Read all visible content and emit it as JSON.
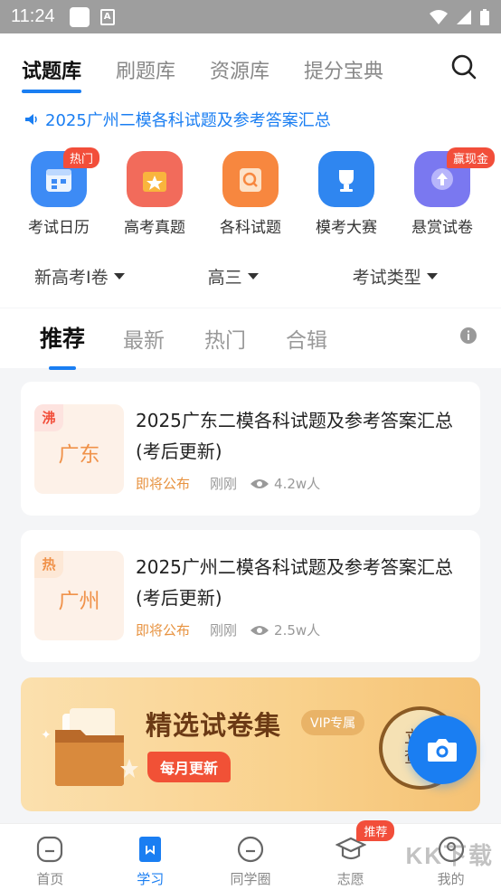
{
  "status_bar": {
    "time": "11:24"
  },
  "top_tabs": [
    "试题库",
    "刷题库",
    "资源库",
    "提分宝典"
  ],
  "notice": "2025广州二模各科试题及参考答案汇总",
  "quick_entries": [
    {
      "label": "考试日历",
      "badge": "热门",
      "color": "#3d8bf5",
      "icon": "calendar-icon"
    },
    {
      "label": "高考真题",
      "badge": "",
      "color": "#f26b5b",
      "icon": "star-folder-icon"
    },
    {
      "label": "各科试题",
      "badge": "",
      "color": "#f7873f",
      "icon": "search-doc-icon"
    },
    {
      "label": "模考大赛",
      "badge": "",
      "color": "#2f86f0",
      "icon": "trophy-icon"
    },
    {
      "label": "悬赏试卷",
      "badge": "赢现金",
      "color": "#7a78f0",
      "icon": "upload-icon"
    }
  ],
  "filters": [
    "新高考Ⅰ卷",
    "高三",
    "考试类型"
  ],
  "feed_tabs": [
    "推荐",
    "最新",
    "热门",
    "合辑"
  ],
  "cards": [
    {
      "tag": "沸",
      "tag_color": "#f24e3a",
      "city": "广东",
      "title": "2025广东二模各科试题及参考答案汇总(考后更新)",
      "status": "即将公布",
      "time": "刚刚",
      "views": "4.2w人"
    },
    {
      "tag": "热",
      "tag_color": "#f0924a",
      "city": "广州",
      "title": "2025广州二模各科试题及参考答案汇总(考后更新)",
      "status": "即将公布",
      "time": "刚刚",
      "views": "2.5w人"
    }
  ],
  "banner": {
    "title": "精选试卷集",
    "vip": "VIP专属",
    "subtitle": "每月更新",
    "cta": "立即查看"
  },
  "bottom_nav": [
    {
      "label": "首页",
      "icon": "home-icon",
      "badge": ""
    },
    {
      "label": "学习",
      "icon": "study-icon",
      "badge": ""
    },
    {
      "label": "同学圈",
      "icon": "chat-icon",
      "badge": ""
    },
    {
      "label": "志愿",
      "icon": "graduation-cap-icon",
      "badge": "推荐"
    },
    {
      "label": "我的",
      "icon": "profile-icon",
      "badge": ""
    }
  ],
  "watermark": "KK下载",
  "colors": {
    "accent": "#1a7ef2",
    "status_orange": "#e7923f"
  }
}
